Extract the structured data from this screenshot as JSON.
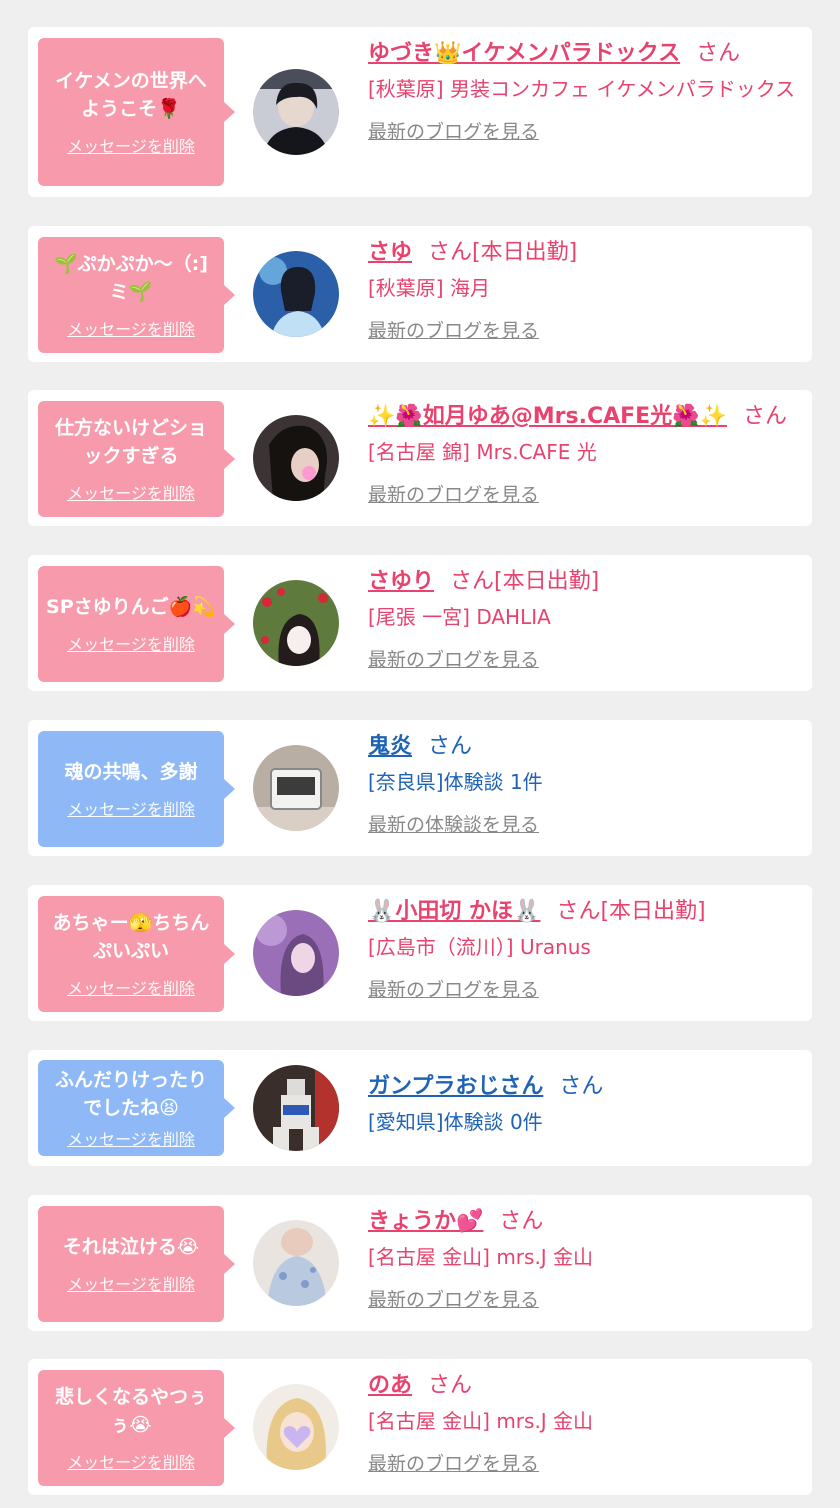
{
  "delete_label": "メッセージを削除",
  "colors": {
    "pink_bubble": "#f79aab",
    "blue_bubble": "#8fb9f6",
    "pink_text": "#e8426e",
    "blue_text": "#1f63b6",
    "link_gray": "#888888",
    "background": "#efefef"
  },
  "items": [
    {
      "message": "イケメンの世界へようこそ🌹",
      "name": "ゆづき👑イケメンパラドックス",
      "suffix": "さん",
      "shop": "[秋葉原] 男装コンカフェ イケメンパラドックス",
      "link": "最新のブログを見る",
      "avatar": "dark-haired-man-photo"
    },
    {
      "message": "🌱ぷかぷか～（:]ミ🌱",
      "name": "さゆ",
      "suffix": "さん[本日出勤]",
      "shop": "[秋葉原] 海月",
      "link": "最新のブログを見る",
      "avatar": "blue-light-girl-photo"
    },
    {
      "message": "仕方ないけどショックすぎる",
      "name": "✨🌺如月ゆあ@Mrs.CAFE光🌺✨",
      "suffix": "さん",
      "shop": "[名古屋 錦] Mrs.CAFE 光",
      "link": "最新のブログを見る",
      "avatar": "dark-portrait-photo"
    },
    {
      "message": "SPさゆりんご🍎💫",
      "name": "さゆり",
      "suffix": "さん[本日出勤]",
      "shop": "[尾張 一宮] DAHLIA",
      "link": "最新のブログを見る",
      "avatar": "strawberry-field-photo"
    },
    {
      "message": "魂の共鳴、多謝",
      "name": "鬼炎",
      "suffix": "さん",
      "shop": "[奈良県]体験談 1件",
      "link": "最新の体験談を見る",
      "avatar": "digital-clock-photo"
    },
    {
      "message": "あちゃー🫣ちちんぷいぷい",
      "name": "🐰小田切 かほ🐰",
      "suffix": "さん[本日出勤]",
      "shop": "[広島市（流川）] Uranus",
      "link": "最新のブログを見る",
      "avatar": "purple-portrait-photo"
    },
    {
      "message": "ふんだりけったりでしたね😫",
      "name": "ガンプラおじさん",
      "suffix": "さん",
      "shop": "[愛知県]体験談 0件",
      "link": "",
      "avatar": "gundam-model-photo"
    },
    {
      "message": "それは泣ける😭",
      "name": "きょうか💕",
      "suffix": "さん",
      "shop": "[名古屋 金山] mrs.J 金山",
      "link": "最新のブログを見る",
      "avatar": "light-dress-photo"
    },
    {
      "message": "悲しくなるやつぅぅ😭",
      "name": "のあ",
      "suffix": "さん",
      "shop": "[名古屋 金山] mrs.J 金山",
      "link": "最新のブログを見る",
      "avatar": "blonde-heart-photo"
    }
  ]
}
